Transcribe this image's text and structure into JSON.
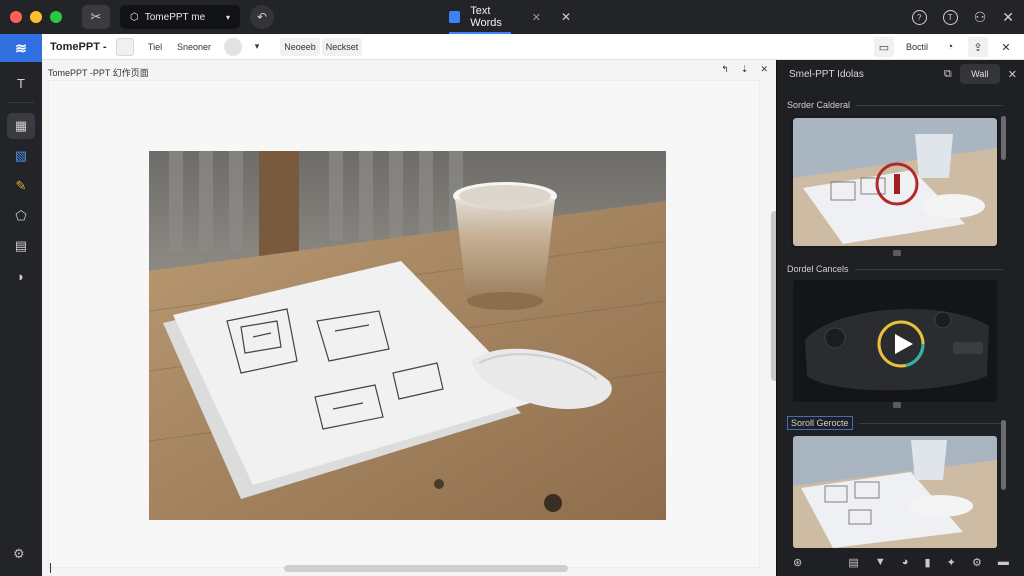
{
  "window": {
    "traffic_colors": [
      "#ff5f57",
      "#febc2e",
      "#28c840"
    ],
    "tab_pill": "TomePPT me",
    "doc_tab": "Text Words",
    "accent": "#2f6fe0"
  },
  "toolbar": {
    "title": "TomePPT -",
    "chip_a": "Tiel",
    "chip_b": "Sneoner",
    "chip_c": "Neoeeb",
    "chip_d": "Neckset",
    "right_label": "Boctil"
  },
  "canvas": {
    "page_label": "TomePPT -PPT 幻作页面"
  },
  "panel": {
    "title": "Smel-PPT Idolas",
    "sel_label": "Wall",
    "sections": [
      "Sorder Calderal",
      "Dordel Cancels",
      "Soroll Gerocte"
    ]
  },
  "icons": {
    "brand": "brand-logo-icon",
    "play": "play-icon",
    "gear": "gear-icon"
  }
}
